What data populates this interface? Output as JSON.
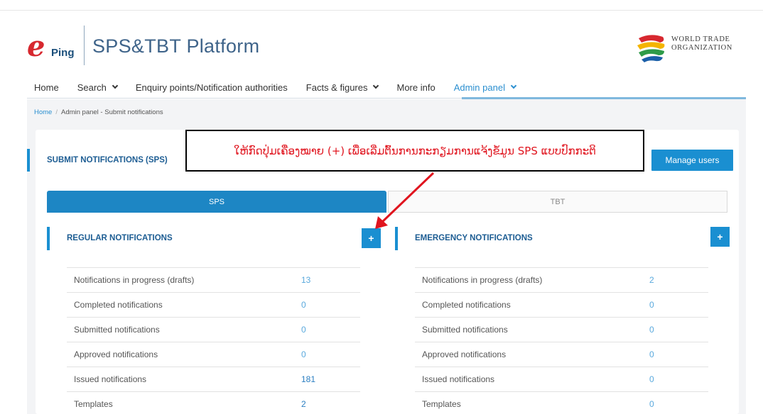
{
  "header": {
    "logo_letter": "e",
    "logo_text": "Ping",
    "platform_title": "SPS&TBT Platform",
    "org_line1": "World Trade",
    "org_line2": "Organization"
  },
  "nav": {
    "items": [
      {
        "label": "Home",
        "dropdown": false
      },
      {
        "label": "Search",
        "dropdown": true
      },
      {
        "label": "Enquiry points/Notification authorities",
        "dropdown": false
      },
      {
        "label": "Facts & figures",
        "dropdown": true
      },
      {
        "label": "More info",
        "dropdown": false
      },
      {
        "label": "Admin panel",
        "dropdown": true,
        "active": true
      }
    ]
  },
  "breadcrumb": {
    "home": "Home",
    "separator": "/",
    "current": "Admin panel - Submit notifications"
  },
  "panel": {
    "title": "SUBMIT NOTIFICATIONS (SPS)",
    "manage_users": "Manage users",
    "tabs": [
      "SPS",
      "TBT"
    ],
    "active_tab": "SPS"
  },
  "annotation": {
    "text": "ໃຫ້ກົດປຸ່ມເຄື່ອງໝາຍ (+) ເພື່ອເລີ່ມຕົ້ນການກະກຽມການແຈ້ງຂໍ້ມູນ SPS ແບບປົກກະຕິ"
  },
  "regular": {
    "title": "REGULAR NOTIFICATIONS",
    "add_label": "+",
    "rows": [
      {
        "label": "Notifications in progress (drafts)",
        "value": "13"
      },
      {
        "label": "Completed notifications",
        "value": "0"
      },
      {
        "label": "Submitted notifications",
        "value": "0"
      },
      {
        "label": "Approved notifications",
        "value": "0"
      },
      {
        "label": "Issued notifications",
        "value": "181"
      },
      {
        "label": "Templates",
        "value": "2"
      }
    ]
  },
  "emergency": {
    "title": "EMERGENCY NOTIFICATIONS",
    "add_label": "+",
    "rows": [
      {
        "label": "Notifications in progress (drafts)",
        "value": "2"
      },
      {
        "label": "Completed notifications",
        "value": "0"
      },
      {
        "label": "Submitted notifications",
        "value": "0"
      },
      {
        "label": "Approved notifications",
        "value": "0"
      },
      {
        "label": "Issued notifications",
        "value": "0"
      },
      {
        "label": "Templates",
        "value": "0"
      }
    ]
  },
  "colors": {
    "accent": "#1a8fd1",
    "brand_red": "#d7282f",
    "title_blue": "#1d5d93",
    "annotation_red": "#e0141e"
  }
}
